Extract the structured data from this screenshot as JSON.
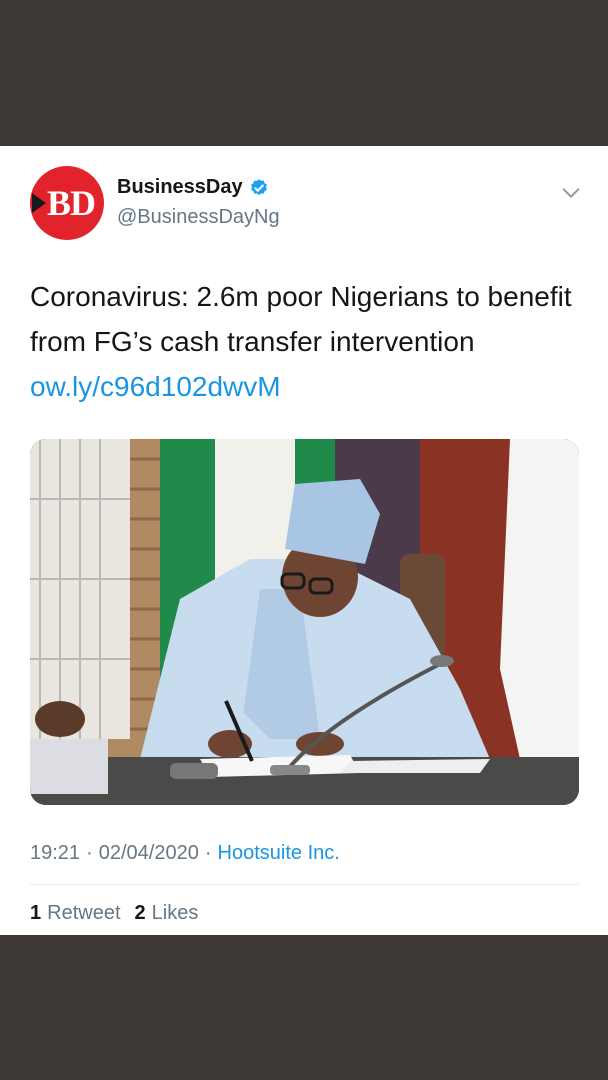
{
  "tweet": {
    "avatar_text": "BD",
    "display_name": "BusinessDay",
    "handle": "@BusinessDayNg",
    "text": "Coronavirus: 2.6m poor Nigerians to benefit from FG’s cash transfer intervention ",
    "link": "ow.ly/c96d102dwvM",
    "time": "19:21",
    "date": "02/04/2020",
    "separator": "·",
    "source": "Hootsuite Inc.",
    "retweet_count": "1",
    "retweet_label": "Retweet",
    "like_count": "2",
    "like_label": "Likes"
  },
  "colors": {
    "link": "#1b95e0",
    "avatar": "#e3232c",
    "verified": "#1da1f2",
    "backdrop": "#3d3736"
  },
  "icons": {
    "verified": "verified-badge-icon",
    "menu": "chevron-down-icon"
  }
}
